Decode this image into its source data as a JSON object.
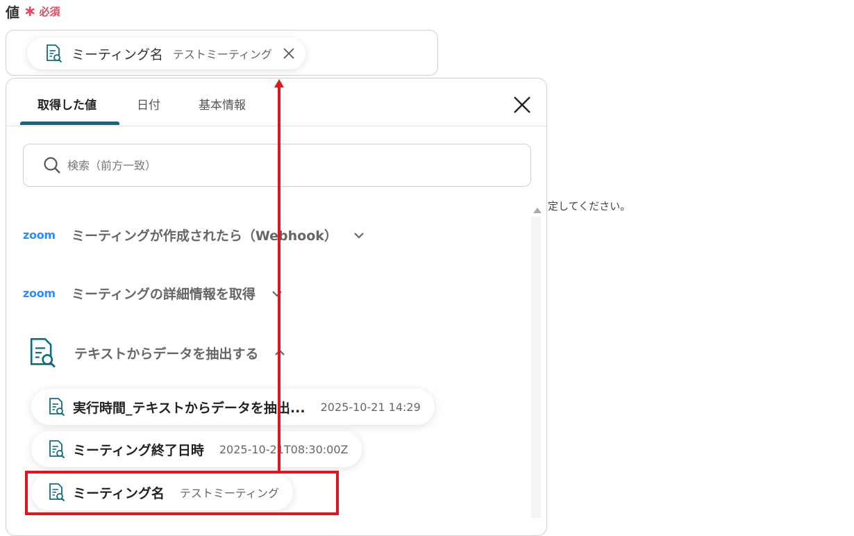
{
  "field": {
    "label": "値",
    "asterisk": "∗",
    "required": "必須"
  },
  "selected_chip": {
    "name": "ミーティング名",
    "value": "テストミーティング"
  },
  "background_hint": "定してください。",
  "panel": {
    "tabs": [
      {
        "label": "取得した値",
        "active": true
      },
      {
        "label": "日付",
        "active": false
      },
      {
        "label": "基本情報",
        "active": false
      }
    ],
    "search_placeholder": "検索（前方一致）",
    "sections": [
      {
        "logo": "zoom",
        "title": "ミーティングが作成されたら（Webhook）",
        "expanded": false
      },
      {
        "logo": "zoom",
        "title": "ミーティングの詳細情報を取得",
        "expanded": false
      },
      {
        "logo": "document-search-icon",
        "title": "テキストからデータを抽出する",
        "expanded": true
      }
    ],
    "items": [
      {
        "name": "実行時間_テキストからデータを抽出...",
        "value": "2025-10-21 14:29"
      },
      {
        "name": "ミーティング終了日時",
        "value": "2025-10-21T08:30:00Z"
      },
      {
        "name": "ミーティング名",
        "value": "テストミーティング",
        "highlighted": true
      }
    ]
  },
  "colors": {
    "accent": "#0f6c80",
    "required": "#e5475c",
    "zoom": "#2d8cff",
    "annotation": "#e0151f"
  }
}
